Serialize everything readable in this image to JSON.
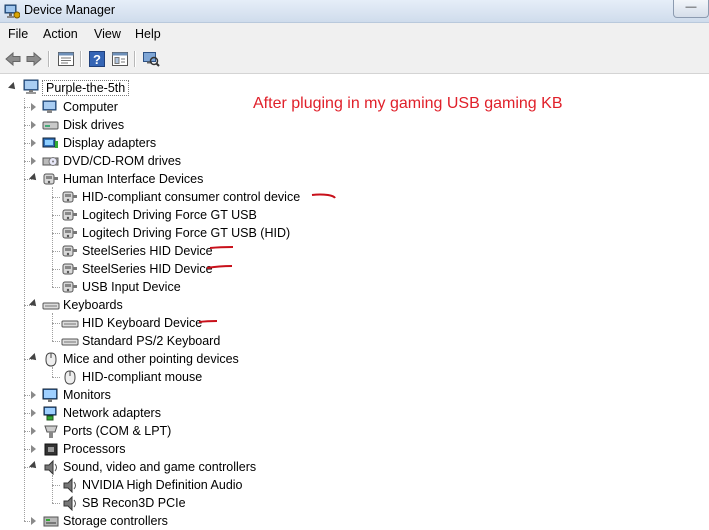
{
  "window": {
    "title": "Device Manager",
    "minimize_glyph": "—",
    "maximize_glyph": "☐"
  },
  "menu": [
    "File",
    "Action",
    "View",
    "Help"
  ],
  "toolbar": {
    "buttons": [
      "back-arrow-icon",
      "forward-arrow-icon",
      "properties-icon",
      "help-icon",
      "view-icon",
      "scan-hardware-icon"
    ]
  },
  "annotation": "After pluging in my gaming USB gaming KB",
  "tree": {
    "root": "Purple-the-5th",
    "categories": [
      {
        "label": "Computer",
        "icon": "computer-icon",
        "expanded": false
      },
      {
        "label": "Disk drives",
        "icon": "disk-drive-icon",
        "expanded": false
      },
      {
        "label": "Display adapters",
        "icon": "display-adapter-icon",
        "expanded": false
      },
      {
        "label": "DVD/CD-ROM drives",
        "icon": "dvd-drive-icon",
        "expanded": false
      },
      {
        "label": "Human Interface Devices",
        "icon": "hid-icon",
        "expanded": true,
        "children": [
          "HID-compliant consumer control device",
          "Logitech Driving Force GT USB",
          "Logitech Driving Force GT USB (HID)",
          "SteelSeries HID Device",
          "SteelSeries HID Device",
          "USB Input Device"
        ]
      },
      {
        "label": "Keyboards",
        "icon": "keyboard-icon",
        "expanded": true,
        "children": [
          "HID Keyboard Device",
          "Standard PS/2 Keyboard"
        ]
      },
      {
        "label": "Mice and other pointing devices",
        "icon": "mouse-icon",
        "expanded": true,
        "children": [
          "HID-compliant mouse"
        ]
      },
      {
        "label": "Monitors",
        "icon": "monitor-icon",
        "expanded": false
      },
      {
        "label": "Network adapters",
        "icon": "network-adapter-icon",
        "expanded": false
      },
      {
        "label": "Ports (COM & LPT)",
        "icon": "port-icon",
        "expanded": false
      },
      {
        "label": "Processors",
        "icon": "processor-icon",
        "expanded": false
      },
      {
        "label": "Sound, video and game controllers",
        "icon": "speaker-icon",
        "expanded": true,
        "children": [
          "NVIDIA High Definition Audio",
          "SB Recon3D PCIe"
        ]
      },
      {
        "label": "Storage controllers",
        "icon": "storage-controller-icon",
        "expanded": false
      }
    ]
  },
  "colors": {
    "annotation": "#e0202a",
    "toolbar_bg": "#f0f0f0"
  }
}
